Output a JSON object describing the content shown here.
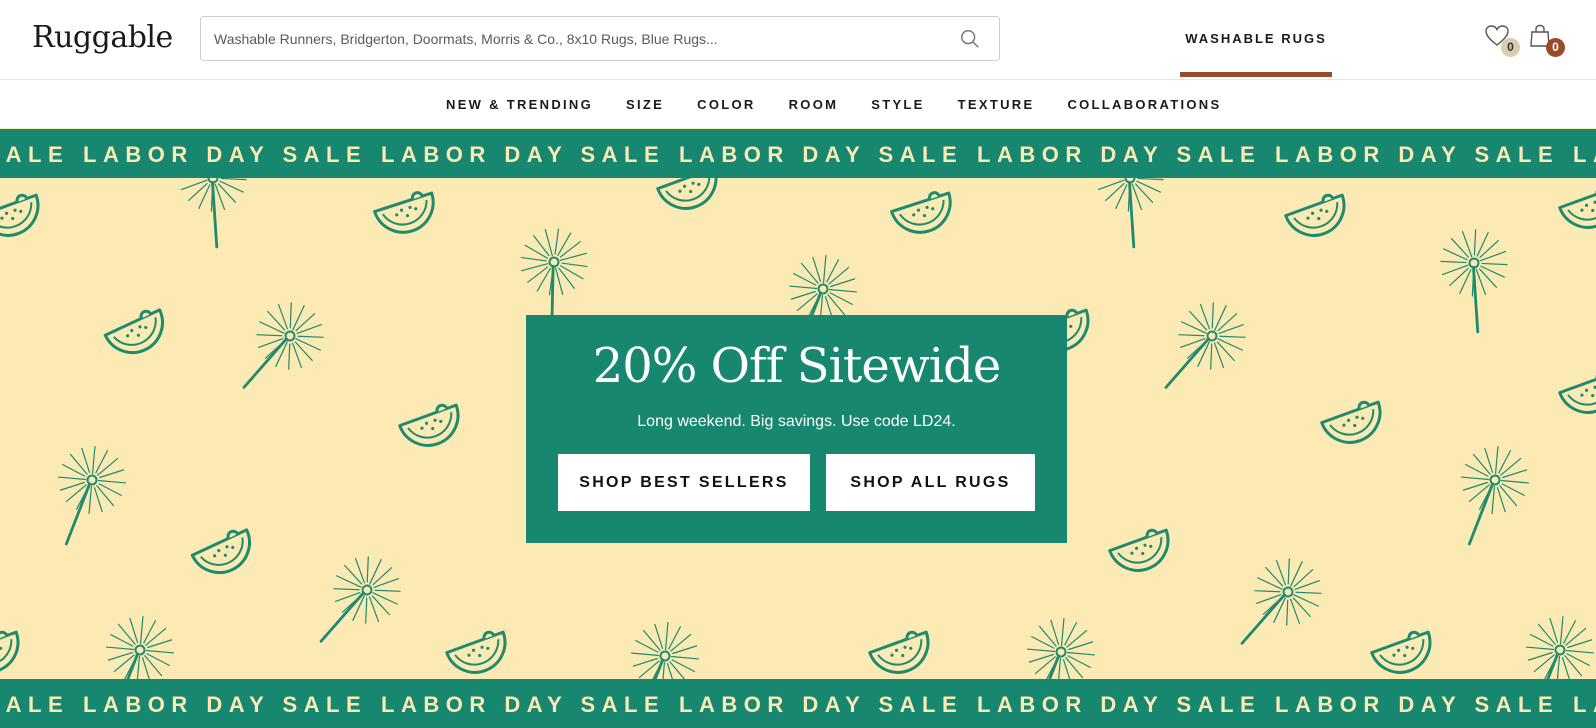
{
  "header": {
    "logo": "Ruggable",
    "search_placeholder": "Washable Runners, Bridgerton, Doormats, Morris & Co., 8x10 Rugs, Blue Rugs...",
    "washable_label": "WASHABLE RUGS",
    "wishlist_count": "0",
    "cart_count": "0"
  },
  "nav": {
    "items": [
      "NEW & TRENDING",
      "SIZE",
      "COLOR",
      "ROOM",
      "STYLE",
      "TEXTURE",
      "COLLABORATIONS"
    ]
  },
  "ticker": {
    "text": "LABOR DAY SALE"
  },
  "hero": {
    "title": "20% Off Sitewide",
    "subtitle": "Long weekend. Big savings. Use code LD24.",
    "button_best": "SHOP BEST SELLERS",
    "button_all": "SHOP ALL RUGS"
  },
  "colors": {
    "brand_green": "#17876f",
    "cream": "#fbeab4",
    "accent_rust": "#9c4a2c"
  },
  "icons": [
    "search-icon",
    "heart-icon",
    "shopping-bag-icon",
    "watermelon-icon",
    "sparkler-icon"
  ]
}
